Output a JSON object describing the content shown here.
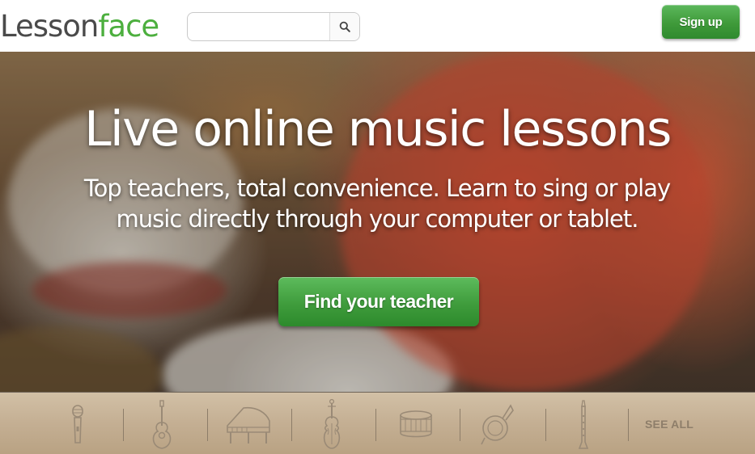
{
  "header": {
    "logo_part1": "Lesson",
    "logo_part2": "face",
    "search": {
      "value": "",
      "placeholder": "",
      "button_icon": "search-icon"
    },
    "signup_label": "Sign up"
  },
  "hero": {
    "title": "Live online music lessons",
    "subtitle": "Top teachers, total convenience. Learn to sing or play music directly through your computer or tablet.",
    "cta_label": "Find your teacher"
  },
  "instruments": {
    "icons": [
      "microphone-icon",
      "guitar-icon",
      "piano-icon",
      "violin-icon",
      "drum-icon",
      "french-horn-icon",
      "clarinet-icon"
    ],
    "see_all_label": "SEE ALL"
  },
  "colors": {
    "brand_green": "#4caf3e",
    "logo_gray": "#4a4a4a",
    "button_green": "#3f9c3c",
    "instrument_bar": "#c4af93",
    "instrument_icon": "#9a8a76"
  }
}
